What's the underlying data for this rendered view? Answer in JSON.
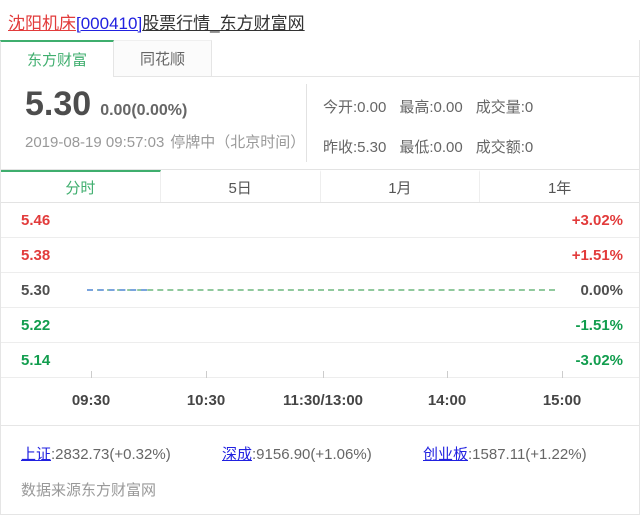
{
  "page_title": {
    "name": "沈阳机床",
    "code": "[000410]",
    "suffix": "股票行情_东方财富网"
  },
  "source_tabs": [
    {
      "label": "东方财富",
      "active": true
    },
    {
      "label": "同花顺",
      "active": false
    }
  ],
  "quote": {
    "price": "5.30",
    "change": "0.00(0.00%)",
    "datetime": "2019-08-19 09:57:03",
    "status": "停牌中（北京时间）",
    "stats_rows": [
      [
        "今开:0.00",
        "最高:0.00",
        "成交量:0"
      ],
      [
        "昨收:5.30",
        "最低:0.00",
        "成交额:0"
      ]
    ]
  },
  "period_tabs": [
    {
      "label": "分时",
      "active": true
    },
    {
      "label": "5日",
      "active": false
    },
    {
      "label": "1月",
      "active": false
    },
    {
      "label": "1年",
      "active": false
    }
  ],
  "chart_data": {
    "type": "line",
    "title": "分时 (intraday minute chart, stock suspended)",
    "price_levels": [
      {
        "price": "5.46",
        "percent": "+3.02%",
        "direction": "up"
      },
      {
        "price": "5.38",
        "percent": "+1.51%",
        "direction": "up"
      },
      {
        "price": "5.30",
        "percent": "0.00%",
        "direction": "flat"
      },
      {
        "price": "5.22",
        "percent": "-1.51%",
        "direction": "down"
      },
      {
        "price": "5.14",
        "percent": "-3.02%",
        "direction": "down"
      }
    ],
    "x_ticks": [
      "09:30",
      "10:30",
      "11:30/13:00",
      "14:00",
      "15:00"
    ],
    "ylim": [
      5.14,
      5.46
    ],
    "prev_close": 5.3,
    "series": [
      {
        "name": "price",
        "values": [
          5.3,
          5.3
        ],
        "note": "flat blue line at 5.30 from 09:30 to ~09:57 (suspension)"
      }
    ],
    "reference_line": 5.3
  },
  "indices": [
    {
      "name": "上证",
      "value": ":2832.73(+0.32%)"
    },
    {
      "name": "深成",
      "value": ":9156.90(+1.06%)"
    },
    {
      "name": "创业板",
      "value": ":1587.11(+1.22%)"
    }
  ],
  "source_note": "数据来源东方财富网",
  "colors": {
    "accent_green": "#3fae6e",
    "up_red": "#e23b3b",
    "down_green": "#129d4e",
    "link_blue": "#2121e0",
    "ref_line_green": "#90c99d",
    "price_line_blue": "#7aa4de"
  }
}
